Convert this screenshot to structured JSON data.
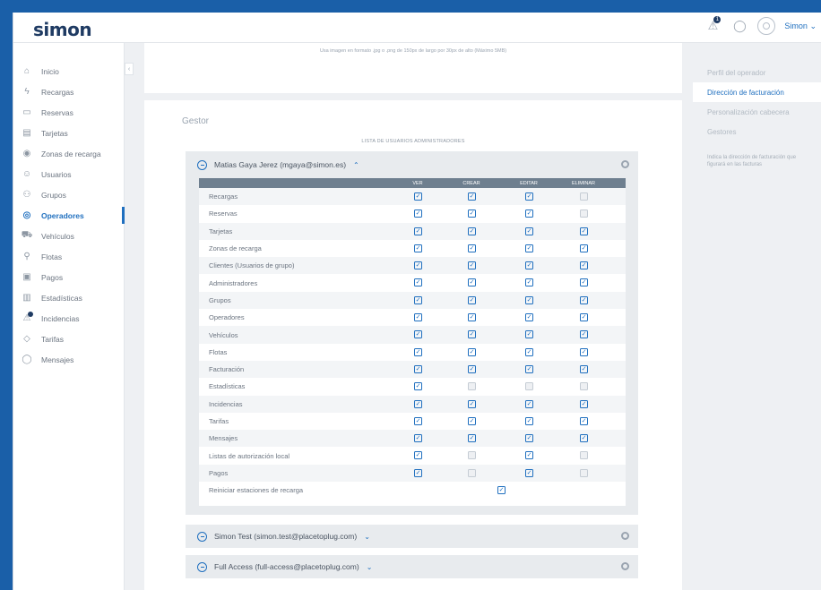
{
  "header": {
    "logo": "simon",
    "alert_badge": "1",
    "user_name": "Simon",
    "user_chevron": "⌄"
  },
  "sidebar": {
    "items": [
      {
        "icon": "⌂",
        "label": "Inicio"
      },
      {
        "icon": "ϟ",
        "label": "Recargas"
      },
      {
        "icon": "▭",
        "label": "Reservas"
      },
      {
        "icon": "▤",
        "label": "Tarjetas"
      },
      {
        "icon": "◉",
        "label": "Zonas de recarga"
      },
      {
        "icon": "☺",
        "label": "Usuarios"
      },
      {
        "icon": "⚇",
        "label": "Grupos"
      },
      {
        "icon": "◎",
        "label": "Operadores"
      },
      {
        "icon": "⛟",
        "label": "Vehículos"
      },
      {
        "icon": "⚲",
        "label": "Flotas"
      },
      {
        "icon": "▣",
        "label": "Pagos"
      },
      {
        "icon": "▥",
        "label": "Estadísticas"
      },
      {
        "icon": "⚠",
        "label": "Incidencias"
      },
      {
        "icon": "◇",
        "label": "Tarifas"
      },
      {
        "icon": "◯",
        "label": "Mensajes"
      }
    ],
    "collapse_glyph": "‹"
  },
  "main": {
    "top_note": "Usa imagen en formato .jpg o .png de 150px de largo por 30px de alto (Máximo 5MB)",
    "section_title": "Gestor",
    "list_title": "LISTA DE USUARIOS ADMINISTRADORES",
    "expanded_user": "Matias Gaya Jerez (mgaya@simon.es)",
    "expand_up": "⌃",
    "expand_down": "⌄",
    "columns": [
      "VER",
      "CREAR",
      "EDITAR",
      "ELIMINAR"
    ],
    "permissions": [
      {
        "name": "Recargas",
        "values": [
          1,
          1,
          1,
          0
        ]
      },
      {
        "name": "Reservas",
        "values": [
          1,
          1,
          1,
          0
        ]
      },
      {
        "name": "Tarjetas",
        "values": [
          1,
          1,
          1,
          1
        ]
      },
      {
        "name": "Zonas de recarga",
        "values": [
          1,
          1,
          1,
          1
        ]
      },
      {
        "name": "Clientes (Usuarios de grupo)",
        "values": [
          1,
          1,
          1,
          1
        ]
      },
      {
        "name": "Administradores",
        "values": [
          1,
          1,
          1,
          1
        ]
      },
      {
        "name": "Grupos",
        "values": [
          1,
          1,
          1,
          1
        ]
      },
      {
        "name": "Operadores",
        "values": [
          1,
          1,
          1,
          1
        ]
      },
      {
        "name": "Vehículos",
        "values": [
          1,
          1,
          1,
          1
        ]
      },
      {
        "name": "Flotas",
        "values": [
          1,
          1,
          1,
          1
        ]
      },
      {
        "name": "Facturación",
        "values": [
          1,
          1,
          1,
          1
        ]
      },
      {
        "name": "Estadísticas",
        "values": [
          1,
          0,
          0,
          0
        ]
      },
      {
        "name": "Incidencias",
        "values": [
          1,
          1,
          1,
          1
        ]
      },
      {
        "name": "Tarifas",
        "values": [
          1,
          1,
          1,
          1
        ]
      },
      {
        "name": "Mensajes",
        "values": [
          1,
          1,
          1,
          1
        ]
      },
      {
        "name": "Listas de autorización local",
        "values": [
          1,
          0,
          1,
          0
        ]
      },
      {
        "name": "Pagos",
        "values": [
          1,
          0,
          1,
          0
        ]
      },
      {
        "name": "Reiniciar estaciones de recarga",
        "single": 1
      }
    ],
    "other_users": [
      "Simon Test (simon.test@placetoplug.com)",
      "Full Access (full-access@placetoplug.com)"
    ]
  },
  "right_panel": {
    "items": [
      "Perfil del operador",
      "Dirección de facturación",
      "Personalización cabecera",
      "Gestores"
    ],
    "active_index": 1,
    "note": "Indica la dirección de facturación que figurará en las facturas"
  },
  "colors": {
    "accent": "#1f6fbf",
    "brand": "#1f3b63",
    "table_header": "#6e7f8f"
  }
}
